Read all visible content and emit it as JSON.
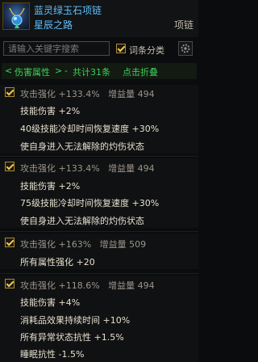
{
  "header": {
    "item_name": "蓝灵绿玉石项链",
    "item_subtitle": "星辰之路",
    "slot": "项链",
    "name_color": "#5ec0ff"
  },
  "toolbar": {
    "search_placeholder": "请输入关键字搜索",
    "category_label": "词条分类",
    "category_checked": true,
    "settings_icon": "gear-icon"
  },
  "section": {
    "expand_symbol": "<",
    "title": "伤害属性",
    "collapse_symbol": ">",
    "count_text": "共计31条",
    "action": "点击折叠"
  },
  "groups": [
    {
      "checked": true,
      "name": "攻击强化",
      "value": "+133.4%",
      "gain_label": "增益量",
      "gain": "494",
      "lines": [
        [
          "技能伤害",
          "+2%"
        ],
        [
          "40级技能冷却时间恢复速度",
          "+30%"
        ],
        [
          "使自身进入无法解除的灼伤状态",
          ""
        ]
      ]
    },
    {
      "checked": true,
      "name": "攻击强化",
      "value": "+133.4%",
      "gain_label": "增益量",
      "gain": "494",
      "lines": [
        [
          "技能伤害",
          "+2%"
        ],
        [
          "75级技能冷却时间恢复速度",
          "+30%"
        ],
        [
          "使自身进入无法解除的灼伤状态",
          ""
        ]
      ]
    },
    {
      "checked": true,
      "name": "攻击强化",
      "value": "+163%",
      "gain_label": "增益量",
      "gain": "509",
      "lines": [
        [
          "所有属性强化",
          "+20"
        ]
      ]
    },
    {
      "checked": true,
      "name": "攻击强化",
      "value": "+118.6%",
      "gain_label": "增益量",
      "gain": "494",
      "lines": [
        [
          "技能伤害",
          "+4%"
        ],
        [
          "消耗品效果持续时间",
          "+10%"
        ],
        [
          "所有异常状态抗性",
          "+1.5%"
        ],
        [
          "睡眠抗性",
          "-1.5%"
        ]
      ]
    }
  ]
}
